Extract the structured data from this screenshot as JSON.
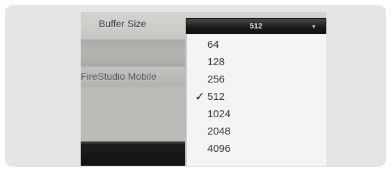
{
  "buffer_size": {
    "label": "Buffer Size",
    "selected": "512",
    "arrow_icon": "chevron-down-icon"
  },
  "device_name": "FireStudio Mobile",
  "dropdown": {
    "options": [
      "64",
      "128",
      "256",
      "512",
      "1024",
      "2048",
      "4096"
    ],
    "checked": "512",
    "check_icon": "checkmark-icon"
  }
}
